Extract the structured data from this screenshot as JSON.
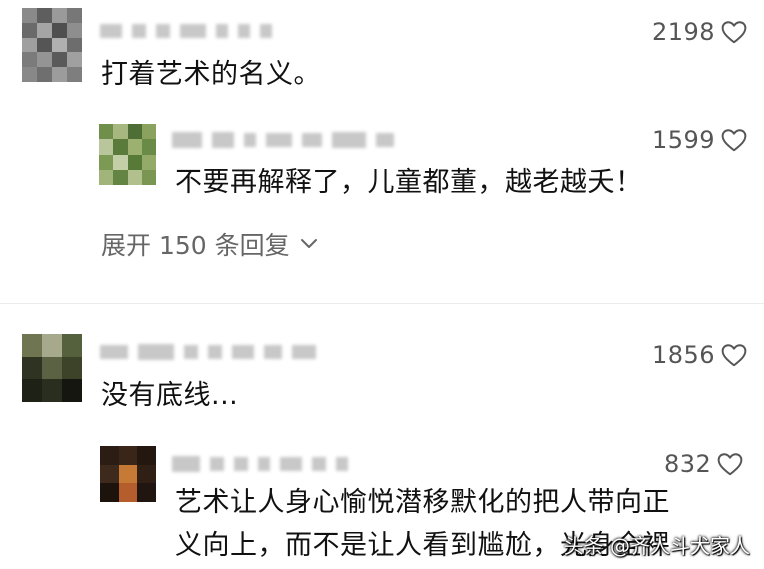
{
  "comments": [
    {
      "likes": "2198",
      "text": "打着艺术的名义。",
      "replies": [
        {
          "likes": "1599",
          "text": "不要再解释了，儿童都董，越老越夭！"
        }
      ],
      "expand_label": "展开 150 条回复"
    },
    {
      "likes": "1856",
      "text": "没有底线...",
      "replies": [
        {
          "likes": "832",
          "text_line1": "艺术让人身心愉悦潜移默化的把人带向正",
          "text_line2": "义向上，而不是让人看到尴尬，光身全裸"
        }
      ]
    }
  ],
  "watermark": "头条 @齐人斗犬家人",
  "colors": {
    "like_text": "#555555",
    "divider": "#ececec",
    "expand_text": "#666666"
  },
  "icons": {
    "like": "heart-outline-icon",
    "expand": "chevron-down-icon"
  }
}
